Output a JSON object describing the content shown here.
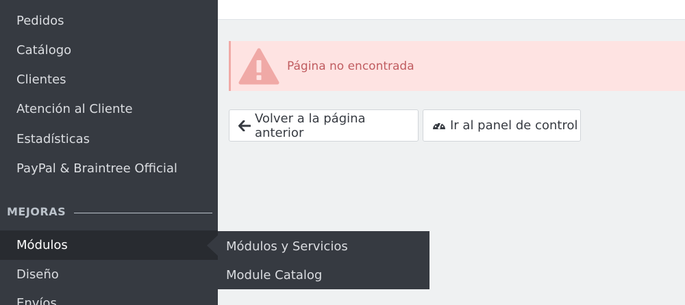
{
  "sidebar": {
    "items_top": [
      {
        "label": "Pedidos"
      },
      {
        "label": "Catálogo"
      },
      {
        "label": "Clientes"
      },
      {
        "label": "Atención al Cliente"
      },
      {
        "label": "Estadísticas"
      },
      {
        "label": "PayPal & Braintree Official"
      }
    ],
    "section_title": "MEJORAS",
    "items_bottom": [
      {
        "label": "Módulos",
        "active": true
      },
      {
        "label": "Diseño"
      },
      {
        "label": "Envíos"
      }
    ]
  },
  "submenu": {
    "items": [
      {
        "label": "Módulos y Servicios"
      },
      {
        "label": "Module Catalog"
      }
    ]
  },
  "alert": {
    "message": "Página no encontrada",
    "icon": "warning-icon"
  },
  "buttons": {
    "back_label": "Volver a la página anterior",
    "back_icon": "arrow-left-icon",
    "dashboard_label": "Ir al panel de control",
    "dashboard_icon": "tachometer-icon"
  },
  "colors": {
    "sidebar_bg": "#363a41",
    "sidebar_active_bg": "#282b30",
    "content_bg": "#eff1f2",
    "alert_bg": "#fee3e2",
    "alert_text": "#c05c60"
  }
}
